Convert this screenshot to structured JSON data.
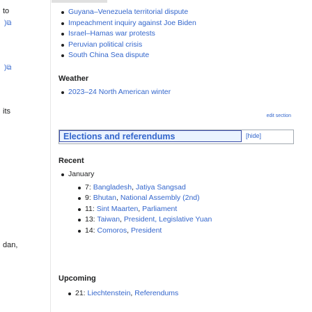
{
  "left": {
    "frags": [
      "to",
      "its",
      "dan,"
    ]
  },
  "ongoing": {
    "items": [
      "Guyana–Venezuela territorial dispute",
      "Impeachment inquiry against Joe Biden",
      "Israel–Hamas war protests",
      "Peruvian political crisis",
      "South China Sea dispute"
    ]
  },
  "weather": {
    "heading": "Weather",
    "items": [
      "2023–24 North American winter"
    ]
  },
  "edit_section": "edit section",
  "elections": {
    "title": "Elections and referendums",
    "hide": "[hide]",
    "recent_heading": "Recent",
    "month": "January",
    "recent": [
      {
        "day": "7:",
        "place": "Bangladesh",
        "detail": "Jatiya Sangsad"
      },
      {
        "day": "9:",
        "place": "Bhutan",
        "detail": "National Assembly (2nd)"
      },
      {
        "day": "11:",
        "place": "Sint Maarten",
        "detail": "Parliament"
      },
      {
        "day": "13:",
        "place": "Taiwan",
        "detail": "President, Legislative Yuan"
      },
      {
        "day": "14:",
        "place": "Comoros",
        "detail": "President"
      }
    ],
    "upcoming_heading": "Upcoming",
    "upcoming": [
      {
        "day": "21:",
        "place": "Liechtenstein",
        "detail": "Referendums"
      }
    ]
  }
}
